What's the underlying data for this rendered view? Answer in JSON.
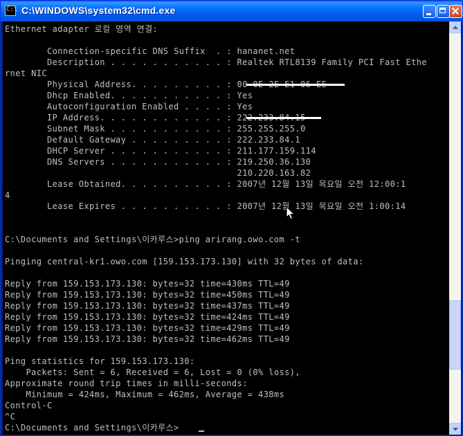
{
  "window": {
    "title": "C:\\WINDOWS\\system32\\cmd.exe",
    "icon": "C:\\",
    "buttons": [
      "minimize-icon",
      "maximize-icon",
      "close-icon"
    ]
  },
  "console": {
    "lines": [
      "Ethernet adapter 로컬 영역 연결:",
      "",
      "        Connection-specific DNS Suffix  . : hananet.net",
      "        Description . . . . . . . . . . . : Realtek RTL8139 Family PCI Fast Ethe",
      "rnet NIC",
      "        Physical Address. . . . . . . . . : 00-0E-2E-E1-06-EE",
      "        Dhcp Enabled. . . . . . . . . . . : Yes",
      "        Autoconfiguration Enabled . . . . : Yes",
      "        IP Address. . . . . . . . . . . . : 222.233.84.15",
      "        Subnet Mask . . . . . . . . . . . : 255.255.255.0",
      "        Default Gateway . . . . . . . . . : 222.233.84.1",
      "        DHCP Server . . . . . . . . . . . : 211.177.159.114",
      "        DNS Servers . . . . . . . . . . . : 219.250.36.130",
      "                                            210.220.163.82",
      "        Lease Obtained. . . . . . . . . . : 2007년 12월 13일 목요일 오전 12:00:1",
      "4",
      "        Lease Expires . . . . . . . . . . : 2007년 12월 13일 목요일 오전 1:00:14",
      "",
      "",
      "C:\\Documents and Settings\\이카루스>ping arirang.owo.com -t",
      "",
      "Pinging central-kr1.owo.com [159.153.173.130] with 32 bytes of data:",
      "",
      "Reply from 159.153.173.130: bytes=32 time=430ms TTL=49",
      "Reply from 159.153.173.130: bytes=32 time=450ms TTL=49",
      "Reply from 159.153.173.130: bytes=32 time=437ms TTL=49",
      "Reply from 159.153.173.130: bytes=32 time=424ms TTL=49",
      "Reply from 159.153.173.130: bytes=32 time=429ms TTL=49",
      "Reply from 159.153.173.130: bytes=32 time=462ms TTL=49",
      "",
      "Ping statistics for 159.153.173.130:",
      "    Packets: Sent = 6, Received = 6, Lost = 0 (0% loss),",
      "Approximate round trip times in milli-seconds:",
      "    Minimum = 424ms, Maximum = 462ms, Average = 438ms",
      "Control-C",
      "^C",
      "C:\\Documents and Settings\\이카루스>"
    ]
  },
  "scrollbar": {
    "icons": [
      "scroll-up-arrow-icon",
      "scroll-down-arrow-icon"
    ]
  },
  "colors": {
    "console_bg": "#000000",
    "console_fg": "#c0c0c0",
    "titlebar": "#0054e3"
  }
}
